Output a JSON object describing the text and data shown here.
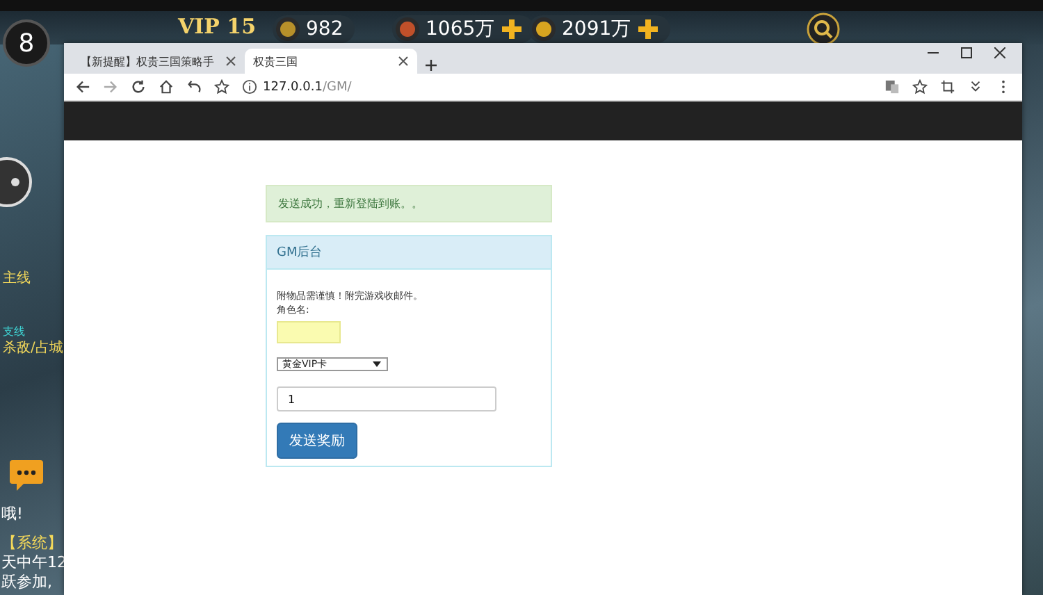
{
  "game": {
    "level": "8",
    "vip": "VIP 15",
    "resources": [
      {
        "value": "982",
        "plus": false
      },
      {
        "value": "1065万",
        "plus": true
      },
      {
        "value": "2091万",
        "plus": true
      }
    ],
    "side_texts": [
      {
        "text": "主线",
        "kind": "quest"
      },
      {
        "text": "支线",
        "kind": "tag"
      },
      {
        "text": "杀敌/占城",
        "kind": "quest"
      }
    ],
    "chat": [
      "哦!",
      "【系统】",
      "天中午12",
      "跃参加,"
    ]
  },
  "browser": {
    "tabs": [
      {
        "title": "【新提醒】权贵三国策略手",
        "selected": false
      },
      {
        "title": "权贵三国",
        "selected": true
      }
    ],
    "url_host": "127.0.0.1",
    "url_path": "/GM/",
    "alert": "发送成功，重新登陆到账。。",
    "panel": {
      "title": "GM后台",
      "notice": "附物品需谨慎！附完游戏收邮件。",
      "role_label": "角色名:",
      "item_select": "黄金VIP卡",
      "amount": "1",
      "submit": "发送奖励"
    }
  }
}
